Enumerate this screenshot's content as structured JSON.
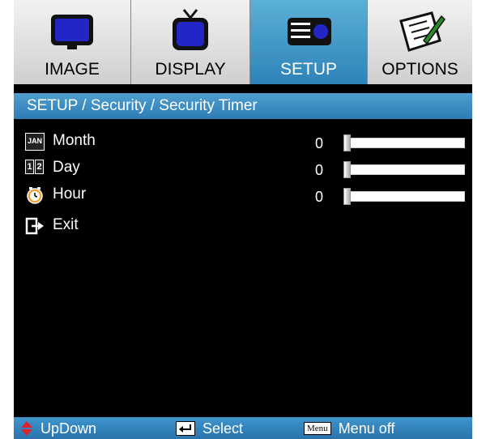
{
  "tabs": [
    {
      "label": "IMAGE",
      "icon": "monitor-icon",
      "active": false
    },
    {
      "label": "DISPLAY",
      "icon": "tv-icon",
      "active": false
    },
    {
      "label": "SETUP",
      "icon": "projector-icon",
      "active": true
    },
    {
      "label": "OPTIONS",
      "icon": "notepad-icon",
      "active": false
    }
  ],
  "breadcrumb": "SETUP / Security / Security Timer",
  "rows": [
    {
      "label": "Month",
      "value": "0",
      "icon": "calendar-icon",
      "icon_text": "JAN"
    },
    {
      "label": "Day",
      "value": "0",
      "icon": "day-digits-icon",
      "icon_text": [
        "1",
        "2"
      ]
    },
    {
      "label": "Hour",
      "value": "0",
      "icon": "clock-icon"
    },
    {
      "label": "Exit",
      "icon": "exit-icon"
    }
  ],
  "footer": {
    "updown": "UpDown",
    "select": "Select",
    "menu_key": "Menu",
    "menu_off": "Menu off"
  },
  "colors": {
    "accent": "#3a8cc4",
    "background": "#000000",
    "tab_inactive": "#e0e0e0",
    "updown_arrow": "#e0202a"
  }
}
